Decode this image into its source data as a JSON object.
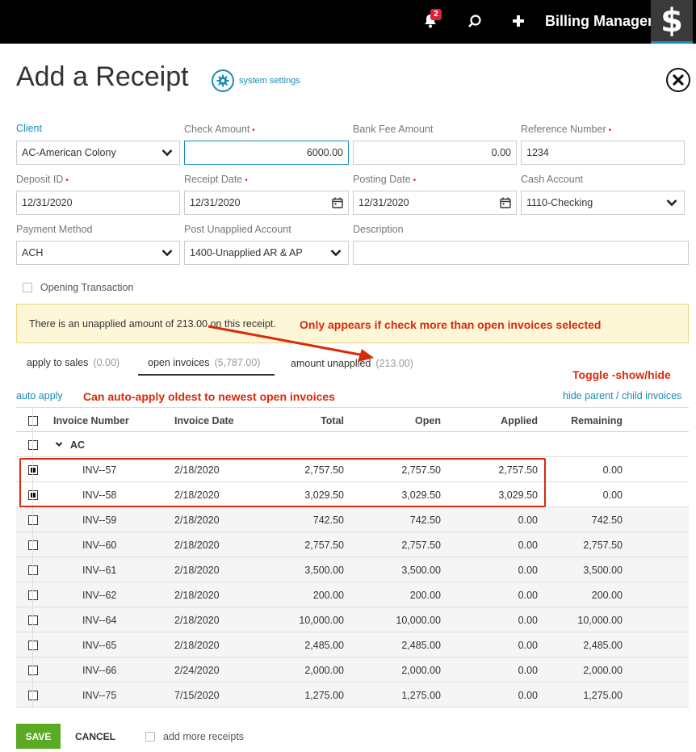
{
  "topbar": {
    "notification_count": "2",
    "app_name": "Billing Manager",
    "logo_glyph": "$"
  },
  "header": {
    "title": "Add a Receipt",
    "settings_label": "system settings"
  },
  "form": {
    "client": {
      "label": "Client",
      "value": "AC-American Colony"
    },
    "check_amount": {
      "label": "Check Amount",
      "value": "6000.00",
      "required": "•"
    },
    "bank_fee": {
      "label": "Bank Fee Amount",
      "value": "0.00"
    },
    "reference_number": {
      "label": "Reference Number",
      "value": "1234",
      "required": "•"
    },
    "deposit_id": {
      "label": "Deposit ID",
      "value": "12/31/2020",
      "required": "•"
    },
    "receipt_date": {
      "label": "Receipt Date",
      "value": "12/31/2020",
      "required": "•"
    },
    "posting_date": {
      "label": "Posting Date",
      "value": "12/31/2020",
      "required": "•"
    },
    "cash_account": {
      "label": "Cash Account",
      "value": "1110-Checking"
    },
    "payment_method": {
      "label": "Payment Method",
      "value": "ACH"
    },
    "post_unapplied": {
      "label": "Post Unapplied Account",
      "value": "1400-Unapplied AR & AP"
    },
    "description": {
      "label": "Description",
      "value": ""
    },
    "opening_transaction": "Opening Transaction"
  },
  "alert": {
    "message": "There is an unapplied amount of 213.00 on this receipt."
  },
  "annotations": {
    "unapplied_note": "Only appears if check more than open invoices selected",
    "toggle_note": "Toggle -show/hide",
    "auto_apply_note": "Can auto-apply oldest to newest open invoices"
  },
  "tabs": [
    {
      "label": "apply to sales",
      "count": "(0.00)"
    },
    {
      "label": "open invoices",
      "count": "(5,787.00)"
    },
    {
      "label": "amount unapplied",
      "count": "(213.00)"
    }
  ],
  "links": {
    "auto_apply": "auto apply",
    "hide_parent_child": "hide parent / child invoices"
  },
  "table": {
    "columns": [
      "Invoice Number",
      "Invoice Date",
      "Total",
      "Open",
      "Applied",
      "Remaining"
    ],
    "group_label": "AC",
    "rows": [
      {
        "checked": true,
        "invoice": "INV--57",
        "date": "2/18/2020",
        "total": "2,757.50",
        "open": "2,757.50",
        "applied": "2,757.50",
        "remaining": "0.00"
      },
      {
        "checked": true,
        "invoice": "INV--58",
        "date": "2/18/2020",
        "total": "3,029.50",
        "open": "3,029.50",
        "applied": "3,029.50",
        "remaining": "0.00"
      },
      {
        "checked": false,
        "invoice": "INV--59",
        "date": "2/18/2020",
        "total": "742.50",
        "open": "742.50",
        "applied": "0.00",
        "remaining": "742.50"
      },
      {
        "checked": false,
        "invoice": "INV--60",
        "date": "2/18/2020",
        "total": "2,757.50",
        "open": "2,757.50",
        "applied": "0.00",
        "remaining": "2,757.50"
      },
      {
        "checked": false,
        "invoice": "INV--61",
        "date": "2/18/2020",
        "total": "3,500.00",
        "open": "3,500.00",
        "applied": "0.00",
        "remaining": "3,500.00"
      },
      {
        "checked": false,
        "invoice": "INV--62",
        "date": "2/18/2020",
        "total": "200.00",
        "open": "200.00",
        "applied": "0.00",
        "remaining": "200.00"
      },
      {
        "checked": false,
        "invoice": "INV--64",
        "date": "2/18/2020",
        "total": "10,000.00",
        "open": "10,000.00",
        "applied": "0.00",
        "remaining": "10,000.00"
      },
      {
        "checked": false,
        "invoice": "INV--65",
        "date": "2/18/2020",
        "total": "2,485.00",
        "open": "2,485.00",
        "applied": "0.00",
        "remaining": "2,485.00"
      },
      {
        "checked": false,
        "invoice": "INV--66",
        "date": "2/24/2020",
        "total": "2,000.00",
        "open": "2,000.00",
        "applied": "0.00",
        "remaining": "2,000.00"
      },
      {
        "checked": false,
        "invoice": "INV--75",
        "date": "7/15/2020",
        "total": "1,275.00",
        "open": "1,275.00",
        "applied": "0.00",
        "remaining": "1,275.00"
      }
    ]
  },
  "footer": {
    "save_label": "SAVE",
    "cancel_label": "CANCEL",
    "add_more_label": "add more receipts"
  },
  "colors": {
    "accent": "#1a8ab8",
    "save_green": "#5aaa24",
    "annotation_red": "#d92a0c",
    "required_red": "#d9253b"
  }
}
